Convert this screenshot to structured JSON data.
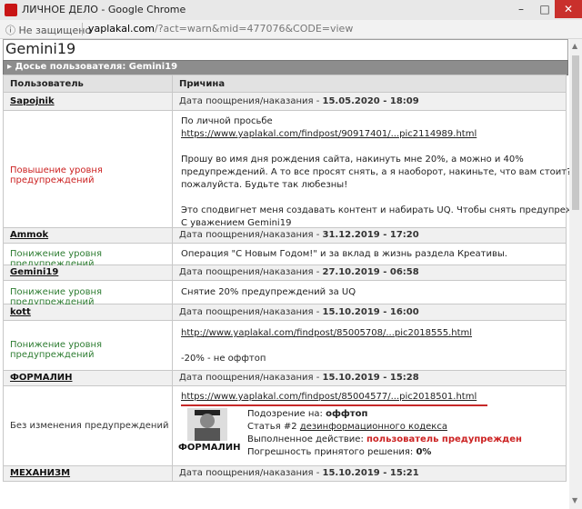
{
  "window": {
    "title": "ЛИЧНОЕ ДЕЛО - Google Chrome"
  },
  "address": {
    "insecure_label": "Не защищено",
    "host": "yaplakal.com",
    "path": "/?act=warn&mid=477076&CODE=view"
  },
  "page": {
    "username": "Gemini19",
    "section_title": "Досье пользователя: Gemini19",
    "columns": {
      "user": "Пользователь",
      "reason": "Причина"
    }
  },
  "rows": [
    {
      "user": "Sapojnik",
      "date_prefix": "Дата поощрения/наказания - ",
      "date": "15.05.2020 - 18:09",
      "action": "Повышение уровня предупреждений",
      "lines": [
        "По личной просьбе",
        "https://www.yaplakal.com/findpost/90917401/...pic2114989.html",
        "",
        "Прошу во имя дня рождения сайта, накинуть мне 20%, а можно и 40%",
        "предупреждений. А то все просят снять, а я наоборот, накиньте, что вам стоит? ну",
        "пожалуйста. Будьте так любезны!",
        "",
        "Это сподвигнет меня создавать контент и набирать UQ. Чтобы снять предупреждения.",
        "",
        "С уважением Gemini19"
      ]
    },
    {
      "user": "Ammok",
      "date_prefix": "Дата поощрения/наказания - ",
      "date": "31.12.2019 - 17:20",
      "action": "Понижение уровня предупреждений",
      "lines": [
        "Операция \"С Новым Годом!\" и за вклад в жизнь раздела Креативы."
      ]
    },
    {
      "user": "Gemini19",
      "date_prefix": "Дата поощрения/наказания - ",
      "date": "27.10.2019 - 06:58",
      "action": "Понижение уровня предупреждений",
      "lines": [
        "Снятие 20% предупреждений за UQ"
      ]
    },
    {
      "user": "kott",
      "date_prefix": "Дата поощрения/наказания - ",
      "date": "15.10.2019 - 16:00",
      "action": "Понижение уровня предупреждений",
      "lines": [
        "http://www.yaplakal.com/findpost/85005708/...pic2018555.html",
        "",
        "-20% - не оффтоп"
      ]
    },
    {
      "user": "ФОРМАЛИН",
      "date_prefix": "Дата поощрения/наказания - ",
      "date": "15.10.2019 - 15:28",
      "action": "Без изменения предупреждений",
      "link": "https://www.yaplakal.com/findpost/85004577/...pic2018501.html",
      "avatar_name": "ФОРМАЛИН",
      "suspicion_label": "Подозрение на: ",
      "suspicion": "оффтоп",
      "article_prefix": "Статья #2 ",
      "article_link": "дезинформационного кодекса",
      "done_label": "Выполненное действие: ",
      "done": "пользователь предупрежден",
      "error_label": "Погрешность принятого решения: ",
      "error": "0%"
    },
    {
      "user": "МЕХАНИЗМ",
      "date_prefix": "Дата поощрения/наказания - ",
      "date": "15.10.2019 - 15:21"
    }
  ]
}
